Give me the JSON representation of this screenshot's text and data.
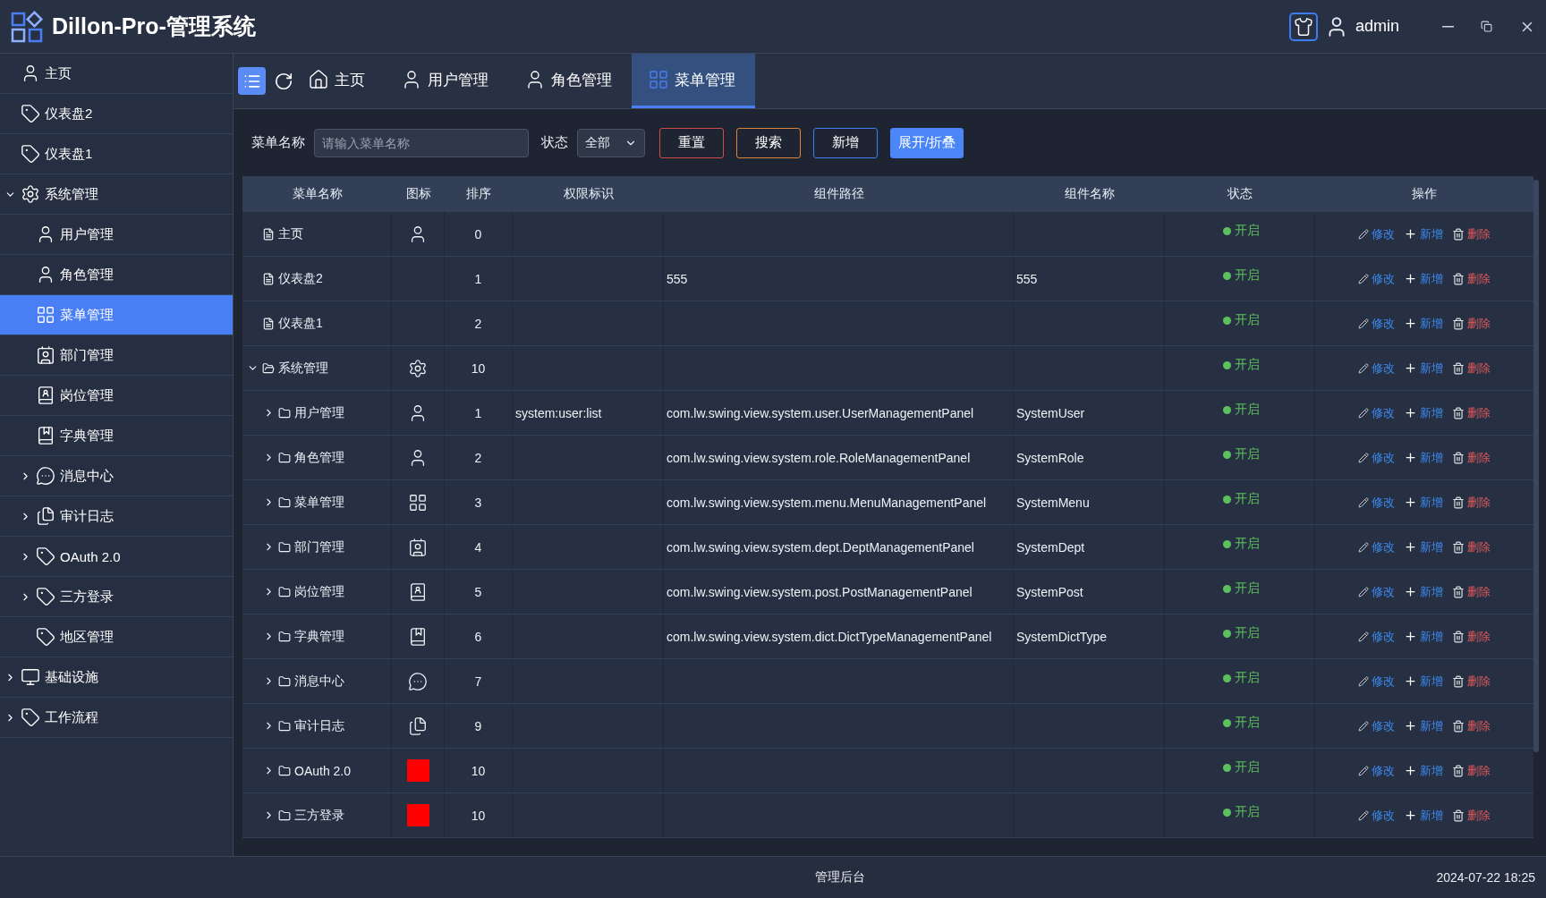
{
  "header": {
    "title": "Dillon-Pro-管理系统",
    "user": "admin"
  },
  "sidebar": {
    "items": [
      {
        "label": "主页",
        "selected": false
      },
      {
        "label": "仪表盘2",
        "selected": false
      },
      {
        "label": "仪表盘1",
        "selected": false
      },
      {
        "label": "系统管理",
        "selected": false,
        "expanded": true,
        "children": [
          {
            "label": "用户管理",
            "selected": false
          },
          {
            "label": "角色管理",
            "selected": false
          },
          {
            "label": "菜单管理",
            "selected": true
          },
          {
            "label": "部门管理",
            "selected": false
          },
          {
            "label": "岗位管理",
            "selected": false
          },
          {
            "label": "字典管理",
            "selected": false
          },
          {
            "label": "消息中心",
            "selected": false,
            "expanded": false
          },
          {
            "label": "审计日志",
            "selected": false,
            "expanded": false
          },
          {
            "label": "OAuth 2.0",
            "selected": false,
            "expanded": false
          },
          {
            "label": "三方登录",
            "selected": false,
            "expanded": false
          },
          {
            "label": "地区管理",
            "selected": false
          }
        ]
      },
      {
        "label": "基础设施",
        "selected": false,
        "expanded": false
      },
      {
        "label": "工作流程",
        "selected": false,
        "expanded": false
      }
    ]
  },
  "tabs": [
    {
      "label": "主页",
      "selected": false
    },
    {
      "label": "用户管理",
      "selected": false
    },
    {
      "label": "角色管理",
      "selected": false
    },
    {
      "label": "菜单管理",
      "selected": true
    }
  ],
  "filter": {
    "name_label": "菜单名称",
    "placeholder": "请输入菜单名称",
    "status_label": "状态",
    "status_value": "全部",
    "buttons": [
      {
        "label": "重置",
        "kind": "reset"
      },
      {
        "label": "搜索",
        "kind": "search"
      },
      {
        "label": "新增",
        "kind": "add"
      },
      {
        "label": "展开/折叠",
        "kind": "toggle"
      }
    ]
  },
  "table": {
    "columns": [
      "菜单名称",
      "图标",
      "排序",
      "权限标识",
      "组件路径",
      "组件名称",
      "状态",
      "操作"
    ],
    "rows": [
      {
        "name": "主页",
        "order": "0",
        "status": "开启",
        "on": true,
        "actions": [
          "修改",
          "新增",
          "删除"
        ]
      },
      {
        "name": "仪表盘2",
        "order": "1",
        "path": "555",
        "component": "555",
        "status": "开启",
        "on": true,
        "actions": [
          "修改",
          "新增",
          "删除"
        ]
      },
      {
        "name": "仪表盘1",
        "order": "2",
        "status": "开启",
        "on": true,
        "actions": [
          "修改",
          "新增",
          "删除"
        ]
      },
      {
        "name": "系统管理",
        "order": "10",
        "expanded": true,
        "status": "开启",
        "on": true,
        "actions": [
          "修改",
          "新增",
          "删除"
        ],
        "children": [
          {
            "name": "用户管理",
            "order": "1",
            "expanded": false,
            "permission": "system:user:list",
            "path": "com.lw.swing.view.system.user.UserManagementPanel",
            "component": "SystemUser",
            "status": "开启",
            "on": true,
            "actions": [
              "修改",
              "新增",
              "删除"
            ]
          },
          {
            "name": "角色管理",
            "order": "2",
            "expanded": false,
            "path": "com.lw.swing.view.system.role.RoleManagementPanel",
            "component": "SystemRole",
            "status": "开启",
            "on": true,
            "actions": [
              "修改",
              "新增",
              "删除"
            ]
          },
          {
            "name": "菜单管理",
            "order": "3",
            "expanded": false,
            "path": "com.lw.swing.view.system.menu.MenuManagementPanel",
            "component": "SystemMenu",
            "status": "开启",
            "on": true,
            "actions": [
              "修改",
              "新增",
              "删除"
            ]
          },
          {
            "name": "部门管理",
            "order": "4",
            "expanded": false,
            "path": "com.lw.swing.view.system.dept.DeptManagementPanel",
            "component": "SystemDept",
            "status": "开启",
            "on": true,
            "actions": [
              "修改",
              "新增",
              "删除"
            ]
          },
          {
            "name": "岗位管理",
            "order": "5",
            "expanded": false,
            "path": "com.lw.swing.view.system.post.PostManagementPanel",
            "component": "SystemPost",
            "status": "开启",
            "on": true,
            "actions": [
              "修改",
              "新增",
              "删除"
            ]
          },
          {
            "name": "字典管理",
            "order": "6",
            "expanded": false,
            "path": "com.lw.swing.view.system.dict.DictTypeManagementPanel",
            "component": "SystemDictType",
            "status": "开启",
            "on": true,
            "actions": [
              "修改",
              "新增",
              "删除"
            ]
          },
          {
            "name": "消息中心",
            "order": "7",
            "expanded": false,
            "status": "开启",
            "on": true,
            "actions": [
              "修改",
              "新增",
              "删除"
            ]
          },
          {
            "name": "审计日志",
            "order": "9",
            "expanded": false,
            "status": "开启",
            "on": true,
            "actions": [
              "修改",
              "新增",
              "删除"
            ]
          },
          {
            "name": "OAuth 2.0",
            "order": "10",
            "expanded": false,
            "status": "开启",
            "on": true,
            "actions": [
              "修改",
              "新增",
              "删除"
            ]
          },
          {
            "name": "三方登录",
            "order": "10",
            "expanded": false,
            "status": "开启",
            "on": true,
            "actions": [
              "修改",
              "新增",
              "删除"
            ]
          }
        ]
      }
    ]
  },
  "status_bar": {
    "center": "管理后台",
    "time": "2024-07-22 18:25"
  }
}
